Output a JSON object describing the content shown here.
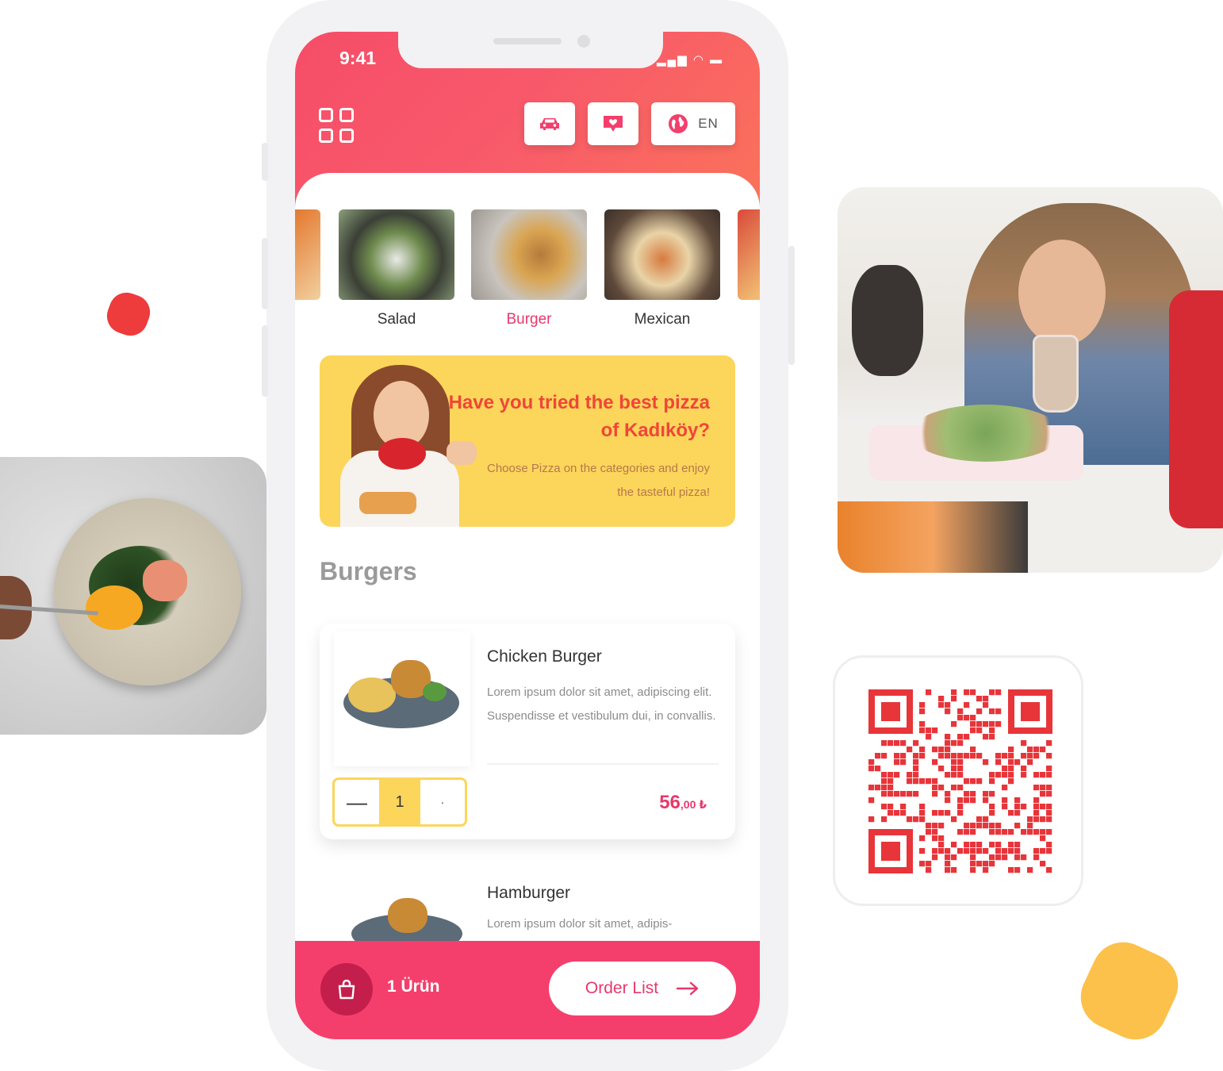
{
  "status_bar": {
    "time": "9:41",
    "icons": [
      "signal-icon",
      "wifi-icon",
      "battery-icon"
    ]
  },
  "header": {
    "menu_icon": "grid-menu-icon",
    "buttons": [
      {
        "icon": "car-icon"
      },
      {
        "icon": "call-waiter-icon"
      },
      {
        "icon": "globe-icon",
        "label": "EN"
      }
    ]
  },
  "categories": [
    {
      "label": "Salad",
      "active": false
    },
    {
      "label": "Burger",
      "active": true
    },
    {
      "label": "Mexican",
      "active": false
    }
  ],
  "promo": {
    "title": "Have you tried the best pizza of Kadıköy?",
    "subtitle": "Choose Pizza on the categories and enjoy the tasteful pizza!"
  },
  "section": {
    "title": "Burgers"
  },
  "products": [
    {
      "name": "Chicken Burger",
      "description": "Lorem ipsum dolor sit amet, adipiscing elit. Suspendisse et vestibulum dui, in convallis.",
      "quantity": "1",
      "price_main": "56",
      "price_decimal": ",00 ₺"
    },
    {
      "name": "Hamburger",
      "description": "Lorem ipsum dolor sit amet, adipis-"
    }
  ],
  "cart": {
    "count_label": "1 Ürün",
    "order_button": "Order List"
  },
  "colors": {
    "primary": "#f43f6c",
    "accent_yellow": "#fcd55b",
    "qr_red": "#e8353a",
    "promo_title": "#ef4638"
  }
}
